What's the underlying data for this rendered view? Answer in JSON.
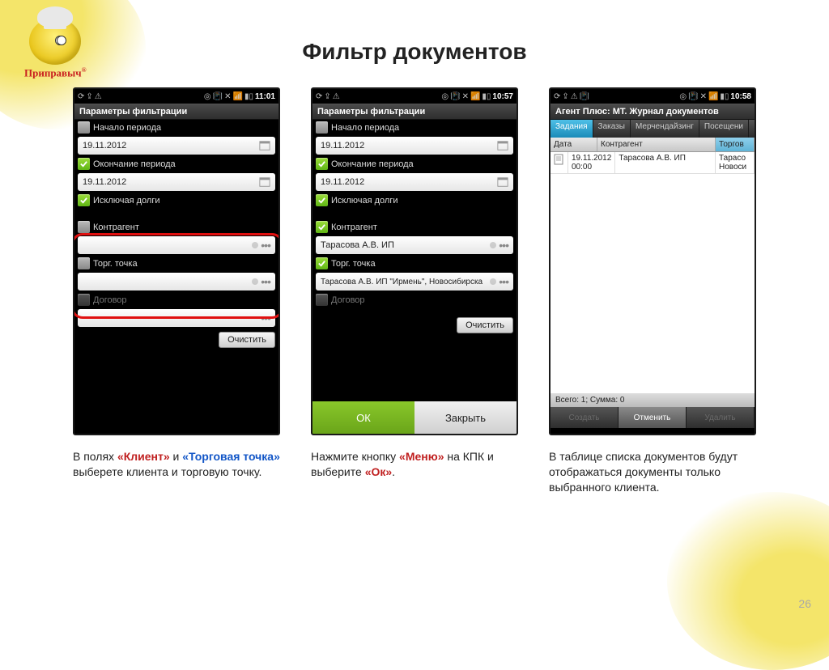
{
  "logo_text": "Приправыч",
  "slide_title": "Фильтр документов",
  "page_number": "26",
  "phone1": {
    "time": "11:01",
    "header": "Параметры фильтрации",
    "labels": {
      "start": "Начало периода",
      "end": "Окончание периода",
      "exclude_debts": "Исключая долги",
      "contragent": "Контрагент",
      "trade_point": "Торг. точка",
      "contract": "Договор"
    },
    "values": {
      "start_date": "19.11.2012",
      "end_date": "19.11.2012",
      "contragent": "",
      "trade_point": ""
    },
    "clear_btn": "Очистить"
  },
  "phone2": {
    "time": "10:57",
    "header": "Параметры фильтрации",
    "labels": {
      "start": "Начало периода",
      "end": "Окончание периода",
      "exclude_debts": "Исключая долги",
      "contragent": "Контрагент",
      "trade_point": "Торг. точка",
      "contract": "Договор"
    },
    "values": {
      "start_date": "19.11.2012",
      "end_date": "19.11.2012",
      "contragent": "Тарасова А.В. ИП",
      "trade_point": "Тарасова А.В. ИП \"Ирмень\", Новосибирска"
    },
    "clear_btn": "Очистить",
    "ok_btn": "ОК",
    "close_btn": "Закрыть"
  },
  "phone3": {
    "time": "10:58",
    "header": "Агент Плюс: МТ. Журнал документов",
    "tabs": [
      "Задания",
      "Заказы",
      "Мерчендайзинг",
      "Посещени"
    ],
    "columns": {
      "date": "Дата",
      "contragent": "Контрагент",
      "trade": "Торгов"
    },
    "row": {
      "date": "19.11.2012",
      "time": "00:00",
      "contragent": "Тарасова А.В. ИП",
      "trade": "Тарасо\nНовоси"
    },
    "status": "Всего: 1; Сумма: 0",
    "actions": {
      "create": "Создать",
      "cancel": "Отменить",
      "delete": "Удалить"
    }
  },
  "captions": {
    "c1_a": "В полях ",
    "c1_b": "«Клиент»",
    "c1_c": " и ",
    "c1_d": "«Торговая точка»",
    "c1_e": " выберете клиента и торговую точку.",
    "c2_a": "Нажмите кнопку ",
    "c2_b": "«Меню»",
    "c2_c": " на КПК и выберите ",
    "c2_d": "«Ок»",
    "c2_e": ".",
    "c3": "В таблице списка документов будут отображаться документы только выбранного клиента."
  }
}
